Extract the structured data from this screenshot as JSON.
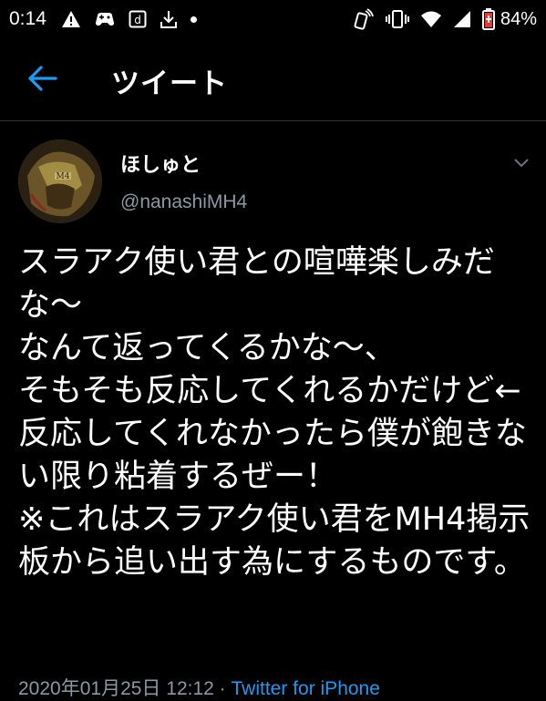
{
  "status_bar": {
    "time": "0:14",
    "left_icons": [
      "warning-icon",
      "game-controller-icon",
      "d-box-icon",
      "download-icon",
      "dot-icon"
    ],
    "right_icons": [
      "nfc-icon",
      "vibrate-icon",
      "wifi-icon",
      "signal-icon",
      "battery-icon"
    ],
    "battery": "84%"
  },
  "header": {
    "title": "ツイート",
    "accent_color": "#1d9bf0"
  },
  "tweet": {
    "display_name": "ほしゅと",
    "handle": "@nanashiMH4",
    "body": "スラアク使い君との喧嘩楽しみだな〜\nなんて返ってくるかな〜、\nそもそも反応してくれるかだけど←\n反応してくれなかったら僕が飽きない限り粘着するぜー！\n※これはスラアク使い君をMH4掲示板から追い出す為にするものです。",
    "timestamp": "2020年01月25日 12:12",
    "separator": " · ",
    "source": "Twitter for iPhone"
  }
}
